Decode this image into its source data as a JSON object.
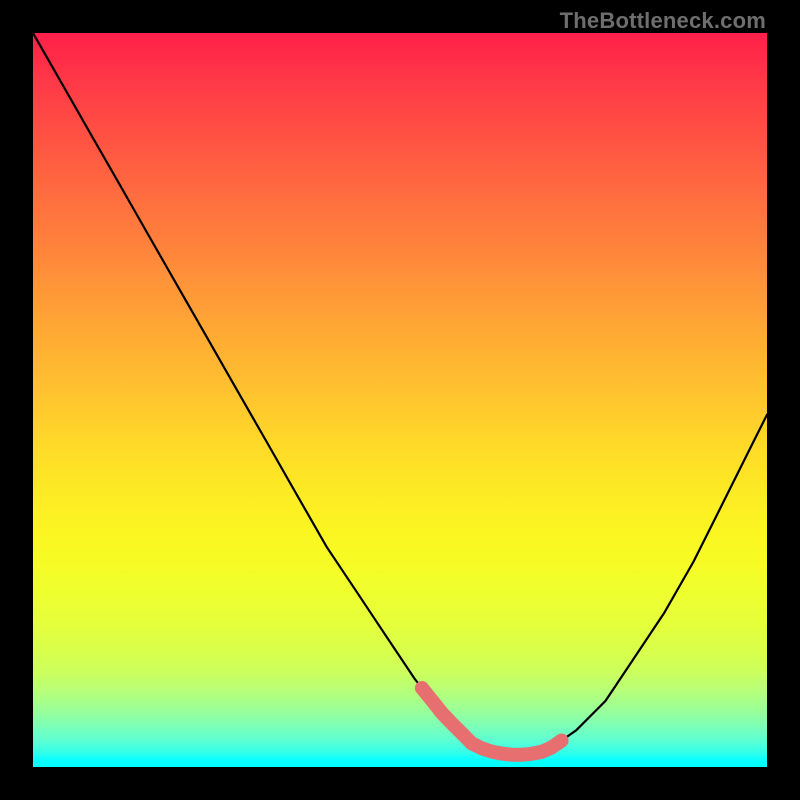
{
  "watermark": "TheBottleneck.com",
  "chart_data": {
    "type": "line",
    "title": "",
    "xlabel": "",
    "ylabel": "",
    "x": [
      0.0,
      0.04,
      0.08,
      0.12,
      0.16,
      0.2,
      0.24,
      0.28,
      0.32,
      0.36,
      0.4,
      0.44,
      0.48,
      0.52,
      0.56,
      0.6,
      0.62,
      0.64,
      0.66,
      0.68,
      0.7,
      0.74,
      0.78,
      0.82,
      0.86,
      0.9,
      0.94,
      0.98,
      1.0
    ],
    "values": [
      1.0,
      0.93,
      0.86,
      0.79,
      0.72,
      0.65,
      0.58,
      0.51,
      0.44,
      0.37,
      0.3,
      0.24,
      0.18,
      0.12,
      0.07,
      0.03,
      0.022,
      0.018,
      0.016,
      0.018,
      0.022,
      0.05,
      0.09,
      0.15,
      0.21,
      0.28,
      0.36,
      0.44,
      0.48
    ],
    "ylim": [
      0,
      1
    ],
    "xlim": [
      0,
      1
    ],
    "highlight_region": {
      "x_start": 0.53,
      "x_end": 0.72,
      "note": "flat basin marked in pink"
    },
    "background": "rainbow vertical gradient red→green",
    "axes_visible": false,
    "grid": false,
    "legend": false
  },
  "colors": {
    "curve_stroke": "#000000",
    "pink_marker": "#e76f6f",
    "frame": "#000000",
    "watermark": "#6e6e6e"
  }
}
